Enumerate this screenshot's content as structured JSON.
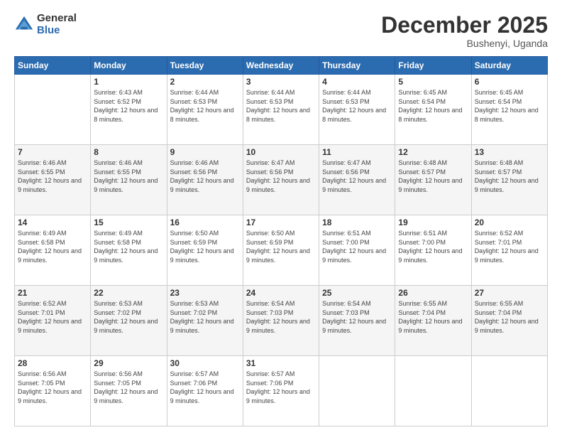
{
  "logo": {
    "general": "General",
    "blue": "Blue"
  },
  "header": {
    "month": "December 2025",
    "location": "Bushenyi, Uganda"
  },
  "weekdays": [
    "Sunday",
    "Monday",
    "Tuesday",
    "Wednesday",
    "Thursday",
    "Friday",
    "Saturday"
  ],
  "weeks": [
    [
      {
        "day": "",
        "sunrise": "",
        "sunset": "",
        "daylight": "",
        "empty": true
      },
      {
        "day": "1",
        "sunrise": "Sunrise: 6:43 AM",
        "sunset": "Sunset: 6:52 PM",
        "daylight": "Daylight: 12 hours and 8 minutes."
      },
      {
        "day": "2",
        "sunrise": "Sunrise: 6:44 AM",
        "sunset": "Sunset: 6:53 PM",
        "daylight": "Daylight: 12 hours and 8 minutes."
      },
      {
        "day": "3",
        "sunrise": "Sunrise: 6:44 AM",
        "sunset": "Sunset: 6:53 PM",
        "daylight": "Daylight: 12 hours and 8 minutes."
      },
      {
        "day": "4",
        "sunrise": "Sunrise: 6:44 AM",
        "sunset": "Sunset: 6:53 PM",
        "daylight": "Daylight: 12 hours and 8 minutes."
      },
      {
        "day": "5",
        "sunrise": "Sunrise: 6:45 AM",
        "sunset": "Sunset: 6:54 PM",
        "daylight": "Daylight: 12 hours and 8 minutes."
      },
      {
        "day": "6",
        "sunrise": "Sunrise: 6:45 AM",
        "sunset": "Sunset: 6:54 PM",
        "daylight": "Daylight: 12 hours and 8 minutes."
      }
    ],
    [
      {
        "day": "7",
        "sunrise": "Sunrise: 6:46 AM",
        "sunset": "Sunset: 6:55 PM",
        "daylight": "Daylight: 12 hours and 9 minutes."
      },
      {
        "day": "8",
        "sunrise": "Sunrise: 6:46 AM",
        "sunset": "Sunset: 6:55 PM",
        "daylight": "Daylight: 12 hours and 9 minutes."
      },
      {
        "day": "9",
        "sunrise": "Sunrise: 6:46 AM",
        "sunset": "Sunset: 6:56 PM",
        "daylight": "Daylight: 12 hours and 9 minutes."
      },
      {
        "day": "10",
        "sunrise": "Sunrise: 6:47 AM",
        "sunset": "Sunset: 6:56 PM",
        "daylight": "Daylight: 12 hours and 9 minutes."
      },
      {
        "day": "11",
        "sunrise": "Sunrise: 6:47 AM",
        "sunset": "Sunset: 6:56 PM",
        "daylight": "Daylight: 12 hours and 9 minutes."
      },
      {
        "day": "12",
        "sunrise": "Sunrise: 6:48 AM",
        "sunset": "Sunset: 6:57 PM",
        "daylight": "Daylight: 12 hours and 9 minutes."
      },
      {
        "day": "13",
        "sunrise": "Sunrise: 6:48 AM",
        "sunset": "Sunset: 6:57 PM",
        "daylight": "Daylight: 12 hours and 9 minutes."
      }
    ],
    [
      {
        "day": "14",
        "sunrise": "Sunrise: 6:49 AM",
        "sunset": "Sunset: 6:58 PM",
        "daylight": "Daylight: 12 hours and 9 minutes."
      },
      {
        "day": "15",
        "sunrise": "Sunrise: 6:49 AM",
        "sunset": "Sunset: 6:58 PM",
        "daylight": "Daylight: 12 hours and 9 minutes."
      },
      {
        "day": "16",
        "sunrise": "Sunrise: 6:50 AM",
        "sunset": "Sunset: 6:59 PM",
        "daylight": "Daylight: 12 hours and 9 minutes."
      },
      {
        "day": "17",
        "sunrise": "Sunrise: 6:50 AM",
        "sunset": "Sunset: 6:59 PM",
        "daylight": "Daylight: 12 hours and 9 minutes."
      },
      {
        "day": "18",
        "sunrise": "Sunrise: 6:51 AM",
        "sunset": "Sunset: 7:00 PM",
        "daylight": "Daylight: 12 hours and 9 minutes."
      },
      {
        "day": "19",
        "sunrise": "Sunrise: 6:51 AM",
        "sunset": "Sunset: 7:00 PM",
        "daylight": "Daylight: 12 hours and 9 minutes."
      },
      {
        "day": "20",
        "sunrise": "Sunrise: 6:52 AM",
        "sunset": "Sunset: 7:01 PM",
        "daylight": "Daylight: 12 hours and 9 minutes."
      }
    ],
    [
      {
        "day": "21",
        "sunrise": "Sunrise: 6:52 AM",
        "sunset": "Sunset: 7:01 PM",
        "daylight": "Daylight: 12 hours and 9 minutes."
      },
      {
        "day": "22",
        "sunrise": "Sunrise: 6:53 AM",
        "sunset": "Sunset: 7:02 PM",
        "daylight": "Daylight: 12 hours and 9 minutes."
      },
      {
        "day": "23",
        "sunrise": "Sunrise: 6:53 AM",
        "sunset": "Sunset: 7:02 PM",
        "daylight": "Daylight: 12 hours and 9 minutes."
      },
      {
        "day": "24",
        "sunrise": "Sunrise: 6:54 AM",
        "sunset": "Sunset: 7:03 PM",
        "daylight": "Daylight: 12 hours and 9 minutes."
      },
      {
        "day": "25",
        "sunrise": "Sunrise: 6:54 AM",
        "sunset": "Sunset: 7:03 PM",
        "daylight": "Daylight: 12 hours and 9 minutes."
      },
      {
        "day": "26",
        "sunrise": "Sunrise: 6:55 AM",
        "sunset": "Sunset: 7:04 PM",
        "daylight": "Daylight: 12 hours and 9 minutes."
      },
      {
        "day": "27",
        "sunrise": "Sunrise: 6:55 AM",
        "sunset": "Sunset: 7:04 PM",
        "daylight": "Daylight: 12 hours and 9 minutes."
      }
    ],
    [
      {
        "day": "28",
        "sunrise": "Sunrise: 6:56 AM",
        "sunset": "Sunset: 7:05 PM",
        "daylight": "Daylight: 12 hours and 9 minutes."
      },
      {
        "day": "29",
        "sunrise": "Sunrise: 6:56 AM",
        "sunset": "Sunset: 7:05 PM",
        "daylight": "Daylight: 12 hours and 9 minutes."
      },
      {
        "day": "30",
        "sunrise": "Sunrise: 6:57 AM",
        "sunset": "Sunset: 7:06 PM",
        "daylight": "Daylight: 12 hours and 9 minutes."
      },
      {
        "day": "31",
        "sunrise": "Sunrise: 6:57 AM",
        "sunset": "Sunset: 7:06 PM",
        "daylight": "Daylight: 12 hours and 9 minutes."
      },
      {
        "day": "",
        "sunrise": "",
        "sunset": "",
        "daylight": "",
        "empty": true
      },
      {
        "day": "",
        "sunrise": "",
        "sunset": "",
        "daylight": "",
        "empty": true
      },
      {
        "day": "",
        "sunrise": "",
        "sunset": "",
        "daylight": "",
        "empty": true
      }
    ]
  ]
}
